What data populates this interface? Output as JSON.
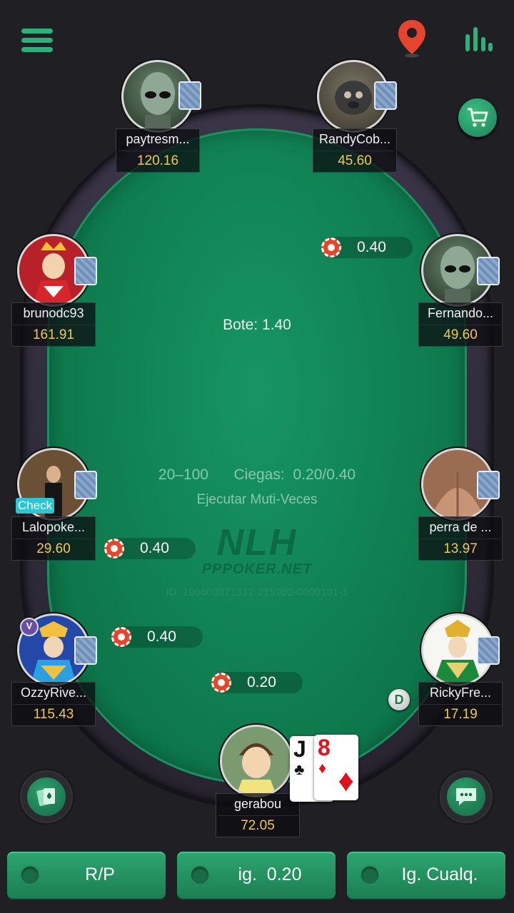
{
  "colors": {
    "felt": "#0f7e50",
    "accent": "#2fb07a",
    "stack": "#f0c75a",
    "button": "#23925f"
  },
  "icons": {
    "menu": "menu-icon",
    "location": "location-pin-icon",
    "stats": "stats-bars-icon",
    "shop": "shopping-cart-icon",
    "cards": "cards-icon",
    "chat": "chat-icon"
  },
  "table": {
    "pot": "Bote: 1.40",
    "stakes": "20–100",
    "blinds": "Ciegas: 0.20/0.40",
    "mode": "Ejecutar Muti-Veces",
    "logo_big": "NLH",
    "logo_small": "PPPOKER.NET",
    "id": "ID: 190603071312-215902-0000101-1",
    "dealer": "D"
  },
  "players": [
    {
      "name": "paytresm...",
      "stack": "120.16"
    },
    {
      "name": "RandyCob...",
      "stack": "45.60"
    },
    {
      "name": "brunodc93",
      "stack": "161.91"
    },
    {
      "name": "Fernando...",
      "stack": "49.60"
    },
    {
      "name": "Lalopoke...",
      "stack": "29.60",
      "action": "Check"
    },
    {
      "name": "perra de ...",
      "stack": "13.97"
    },
    {
      "name": "OzzyRive...",
      "stack": "115.43"
    },
    {
      "name": "RickyFre...",
      "stack": "17.19"
    },
    {
      "name": "gerabou",
      "stack": "72.05"
    }
  ],
  "bets": [
    "0.40",
    "0.40",
    "0.40",
    "0.20"
  ],
  "hero_cards": [
    {
      "rank": "J",
      "suit": "♣"
    },
    {
      "rank": "8",
      "suit": "♦"
    }
  ],
  "actions": {
    "fold": "R/P",
    "call": "ig.  0.20",
    "call_any": "Ig. Cualq."
  }
}
